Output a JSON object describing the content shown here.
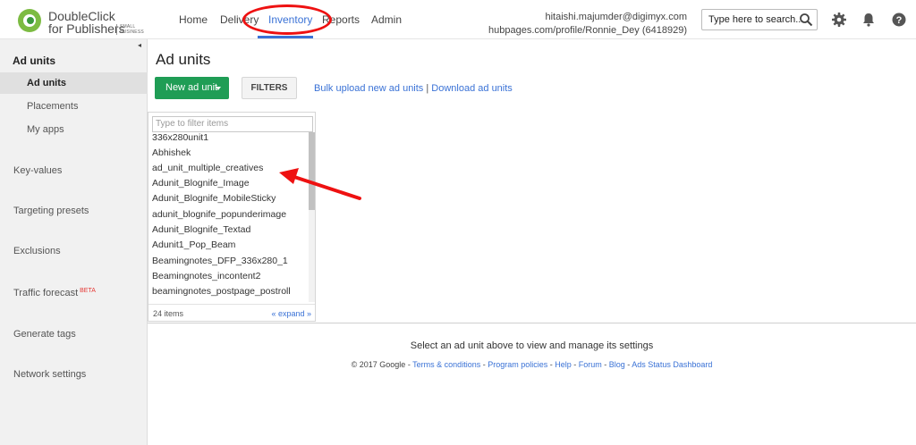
{
  "header": {
    "logo_line1": "DoubleClick",
    "logo_line2": "for Publishers",
    "logo_small1": "SMALL",
    "logo_small2": "BUSINESS",
    "nav": [
      {
        "label": "Home"
      },
      {
        "label": "Delivery"
      },
      {
        "label": "Inventory",
        "active": true
      },
      {
        "label": "Reports"
      },
      {
        "label": "Admin"
      }
    ],
    "account_email": "hitaishi.majumder@digimyx.com",
    "account_network": "hubpages.com/profile/Ronnie_Dey (6418929)",
    "search_placeholder": "Type here to search...",
    "icons": [
      "search-icon",
      "gear-icon",
      "bell-icon",
      "help-icon"
    ],
    "accent_color": "#3a72d6"
  },
  "sidebar": {
    "section": "Ad units",
    "sub_items": [
      {
        "label": "Ad units",
        "active": true
      },
      {
        "label": "Placements"
      },
      {
        "label": "My apps"
      }
    ],
    "items": [
      {
        "label": "Key-values"
      },
      {
        "label": "Targeting presets"
      },
      {
        "label": "Exclusions"
      },
      {
        "label": "Traffic forecast",
        "badge": "BETA"
      },
      {
        "label": "Generate tags"
      },
      {
        "label": "Network settings"
      }
    ]
  },
  "main": {
    "title": "Ad units",
    "new_button": "New ad unit",
    "filters_button": "FILTERS",
    "link_bulk": "Bulk upload new ad units",
    "link_sep": "|",
    "link_download": "Download ad units",
    "filter_placeholder": "Type to filter items",
    "items": [
      "336x280unit1",
      "Abhishek",
      "ad_unit_multiple_creatives",
      "Adunit_Blognife_Image",
      "Adunit_Blognife_MobileSticky",
      "adunit_blognife_popunderimage",
      "Adunit_Blognife_Textad",
      "Adunit1_Pop_Beam",
      "Beamingnotes_DFP_336x280_1",
      "Beamingnotes_incontent2",
      "beamingnotes_postpage_postroll"
    ],
    "count": "24 items",
    "expand": "« expand »",
    "select_message": "Select an ad unit above to view and manage its settings",
    "button_color": "#1f9d55"
  },
  "footer": {
    "copyright": "© 2017 Google",
    "links": [
      "Terms & conditions",
      "Program policies",
      "Help",
      "Forum",
      "Blog",
      "Ads Status Dashboard"
    ]
  },
  "annotation_color": "#e11111"
}
